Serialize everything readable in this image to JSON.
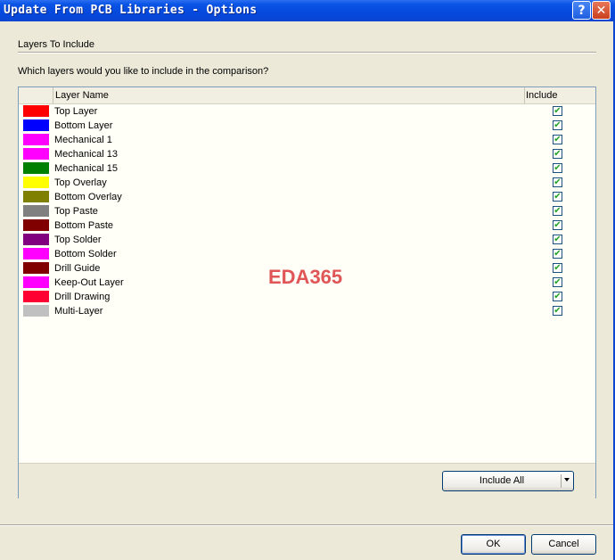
{
  "window": {
    "title": "Update From PCB Libraries - Options",
    "help": "?",
    "close": "✕"
  },
  "section": {
    "title": "Layers To Include",
    "question": "Which layers would you like to include in the comparison?"
  },
  "grid": {
    "columns": {
      "name": "Layer Name",
      "include": "Include"
    },
    "rows": [
      {
        "name": "Top Layer",
        "color": "#ff0000",
        "checked": true
      },
      {
        "name": "Bottom Layer",
        "color": "#0000ff",
        "checked": true
      },
      {
        "name": "Mechanical 1",
        "color": "#ff00ff",
        "checked": true
      },
      {
        "name": "Mechanical 13",
        "color": "#ff00ff",
        "checked": true
      },
      {
        "name": "Mechanical 15",
        "color": "#008000",
        "checked": true
      },
      {
        "name": "Top Overlay",
        "color": "#ffff00",
        "checked": true
      },
      {
        "name": "Bottom Overlay",
        "color": "#808000",
        "checked": true
      },
      {
        "name": "Top Paste",
        "color": "#808080",
        "checked": true
      },
      {
        "name": "Bottom Paste",
        "color": "#800000",
        "checked": true
      },
      {
        "name": "Top Solder",
        "color": "#800080",
        "checked": true
      },
      {
        "name": "Bottom Solder",
        "color": "#ff00ff",
        "checked": true
      },
      {
        "name": "Drill Guide",
        "color": "#800000",
        "checked": true
      },
      {
        "name": "Keep-Out Layer",
        "color": "#ff00ff",
        "checked": true
      },
      {
        "name": "Drill Drawing",
        "color": "#ff0033",
        "checked": true
      },
      {
        "name": "Multi-Layer",
        "color": "#c0c0c0",
        "checked": true
      }
    ],
    "include_all_label": "Include All"
  },
  "watermark": "EDA365",
  "buttons": {
    "ok": "OK",
    "cancel": "Cancel"
  }
}
